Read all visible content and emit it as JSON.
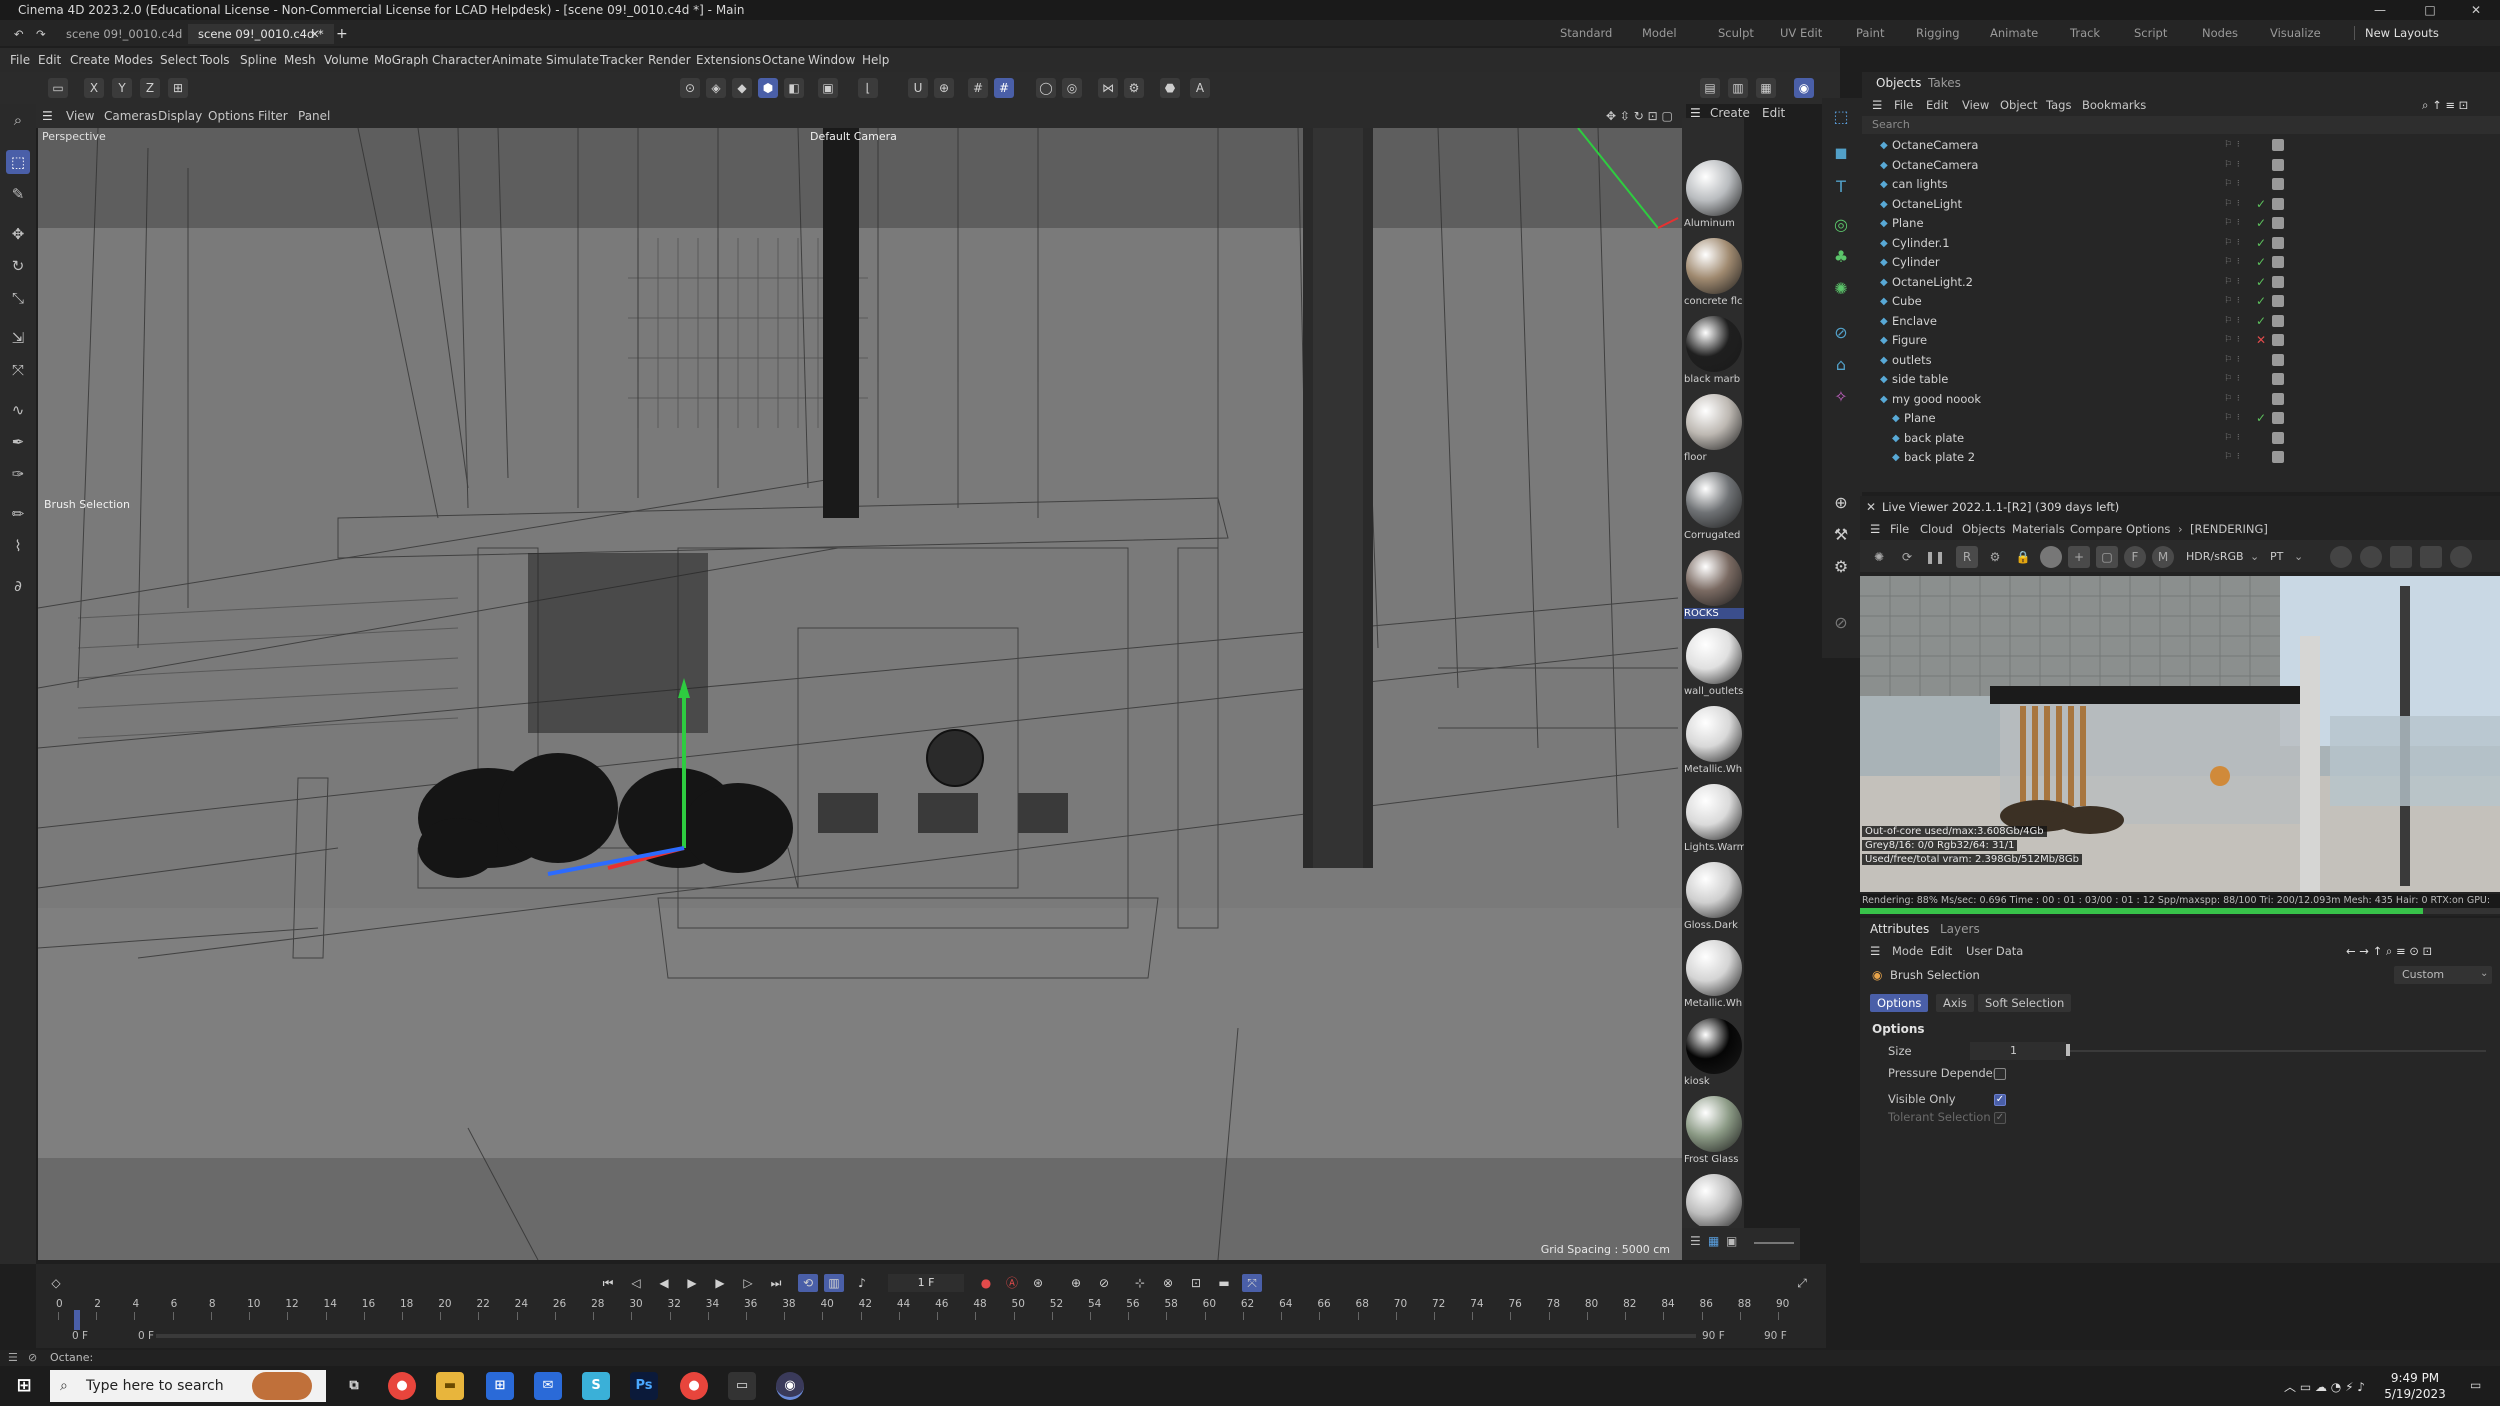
{
  "window": {
    "title": "Cinema 4D 2023.2.0 (Educational License - Non-Commercial License for LCAD Helpdesk) - [scene 09!_0010.c4d *] - Main",
    "minimize": "—",
    "maximize": "□",
    "close": "✕"
  },
  "doc_tabs": [
    {
      "label": "scene 09!_0010.c4d"
    },
    {
      "label": "scene 09!_0010.c4d *"
    }
  ],
  "layout_tabs": [
    "Standard",
    "Model",
    "Sculpt",
    "UV Edit",
    "Paint",
    "Rigging",
    "Animate",
    "Track",
    "Script",
    "Nodes",
    "Visualize"
  ],
  "new_layouts": "New Layouts",
  "menu": [
    "File",
    "Edit",
    "Create",
    "Modes",
    "Select",
    "Tools",
    "Spline",
    "Mesh",
    "Volume",
    "MoGraph",
    "Character",
    "Animate",
    "Simulate",
    "Tracker",
    "Render",
    "Extensions",
    "Octane",
    "Window",
    "Help"
  ],
  "viewport": {
    "menu": [
      "View",
      "Cameras",
      "Display",
      "Options",
      "Filter",
      "Panel"
    ],
    "label": "Perspective",
    "camera": "Default Camera",
    "grid_spacing": "Grid Spacing : 5000 cm",
    "tool_hint": "Brush Selection"
  },
  "materials": [
    {
      "name": "Aluminum",
      "color": "#b9bcbf"
    },
    {
      "name": "concrete flc",
      "color": "#a08a70"
    },
    {
      "name": "black marb",
      "color": "#1f1f1f"
    },
    {
      "name": "floor",
      "color": "#bdb8b2"
    },
    {
      "name": "Corrugated",
      "color": "#6f7275"
    },
    {
      "name": "ROCKS",
      "color": "#7a6a62"
    },
    {
      "name": "wall_outlets",
      "color": "#e0e0e0"
    },
    {
      "name": "Metallic.Wh",
      "color": "#d8d8d8"
    },
    {
      "name": "Lights.Warm",
      "color": "#dadada"
    },
    {
      "name": "Gloss.Dark",
      "color": "#cfcfcf"
    },
    {
      "name": "Metallic.Wh",
      "color": "#d4d4d4"
    },
    {
      "name": "kiosk",
      "color": "#050505"
    },
    {
      "name": "Frost Glass",
      "color": "#8b9a85"
    },
    {
      "name": "",
      "color": "#bdbdbd"
    }
  ],
  "objects_panel": {
    "tabs": [
      "Objects",
      "Takes"
    ],
    "menu": [
      "File",
      "Edit",
      "View",
      "Object",
      "Tags",
      "Bookmarks"
    ],
    "search_placeholder": "Search",
    "rows": [
      {
        "name": "OctaneCamera",
        "indent": 0,
        "check": ""
      },
      {
        "name": "OctaneCamera",
        "indent": 0,
        "check": ""
      },
      {
        "name": "can lights",
        "indent": 0,
        "check": ""
      },
      {
        "name": "OctaneLight",
        "indent": 0,
        "check": "✓"
      },
      {
        "name": "Plane",
        "indent": 0,
        "check": "✓"
      },
      {
        "name": "Cylinder.1",
        "indent": 0,
        "check": "✓"
      },
      {
        "name": "Cylinder",
        "indent": 0,
        "check": "✓"
      },
      {
        "name": "OctaneLight.2",
        "indent": 0,
        "check": "✓"
      },
      {
        "name": "Cube",
        "indent": 0,
        "check": "✓"
      },
      {
        "name": "Enclave",
        "indent": 0,
        "check": "✓"
      },
      {
        "name": "Figure",
        "indent": 0,
        "check": "✕"
      },
      {
        "name": "outlets",
        "indent": 0,
        "check": ""
      },
      {
        "name": "side table",
        "indent": 0,
        "check": ""
      },
      {
        "name": "my good noook",
        "indent": 0,
        "check": ""
      },
      {
        "name": "Plane",
        "indent": 1,
        "check": "✓"
      },
      {
        "name": "back plate",
        "indent": 1,
        "check": ""
      },
      {
        "name": "back plate 2",
        "indent": 1,
        "check": ""
      }
    ]
  },
  "live_viewer": {
    "title": "Live Viewer 2022.1.1-[R2] (309 days left)",
    "menu": [
      "File",
      "Cloud",
      "Objects",
      "Materials",
      "Compare",
      "Options"
    ],
    "state": "[RENDERING]",
    "colorspace": "HDR/sRGB",
    "kernel": "PT",
    "info": [
      "Out-of-core used/max:3.608Gb/4Gb",
      "Grey8/16: 0/0          Rgb32/64: 31/1",
      "Used/free/total vram: 2.398Gb/512Mb/8Gb"
    ],
    "status": "Rendering: 88%   Ms/sec: 0.696   Time : 00 : 01 : 03/00 : 01 : 12   Spp/maxspp: 88/100        Tri: 200/12.093m   Mesh: 435   Hair: 0    RTX:on     GPU:",
    "progress": 0.88
  },
  "attributes": {
    "tabs": [
      "Attributes",
      "Layers"
    ],
    "menu": [
      "Mode",
      "Edit",
      "User Data"
    ],
    "tool": "Brush Selection",
    "preset": "Custom",
    "subtabs": [
      "Options",
      "Axis",
      "Soft Selection"
    ],
    "section": "Options",
    "size_label": "Size",
    "size_value": "1",
    "pressure_label": "Pressure Dependent",
    "visible_only_label": "Visible Only",
    "tolerant_label": "Tolerant Selection"
  },
  "timeline": {
    "ticks": [
      "0",
      "2",
      "4",
      "6",
      "8",
      "10",
      "12",
      "14",
      "16",
      "18",
      "20",
      "22",
      "24",
      "26",
      "28",
      "30",
      "32",
      "34",
      "36",
      "38",
      "40",
      "42",
      "44",
      "46",
      "48",
      "50",
      "52",
      "54",
      "56",
      "58",
      "60",
      "62",
      "64",
      "66",
      "68",
      "70",
      "72",
      "74",
      "76",
      "78",
      "80",
      "82",
      "84",
      "86",
      "88",
      "90"
    ],
    "current_frame": "1 F",
    "start_a": "0 F",
    "start_b": "0 F",
    "end_a": "90 F",
    "end_b": "90 F"
  },
  "statusbar": {
    "text": "Octane:"
  },
  "taskbar": {
    "search_placeholder": "Type here to search",
    "time": "9:49 PM",
    "date": "5/19/2023"
  }
}
